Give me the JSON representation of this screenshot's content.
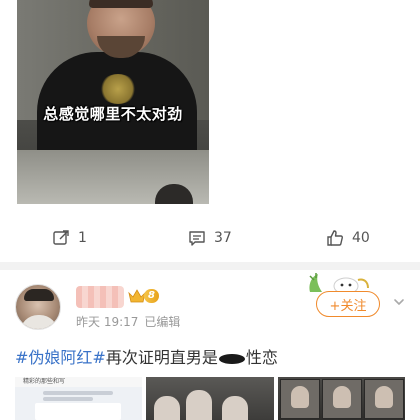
{
  "post1": {
    "image_caption": "总感觉哪里不太对劲",
    "actions": {
      "repost_count": "1",
      "comment_count": "37",
      "like_count": "40"
    }
  },
  "post2": {
    "username": "",
    "vip_level": "8",
    "time": "昨天 19:17",
    "edited_label": "已编辑",
    "follow_label": "+关注",
    "text": {
      "hashtag": "#伪娘阿红#",
      "body_before": "再次证明直男是",
      "body_after": "性恋"
    },
    "image1_header": "精彩的那些和写"
  },
  "colors": {
    "hashtag": "#3a73c8",
    "follow": "#f08a2c",
    "meta": "#999999",
    "divider": "#f2f2f2"
  }
}
